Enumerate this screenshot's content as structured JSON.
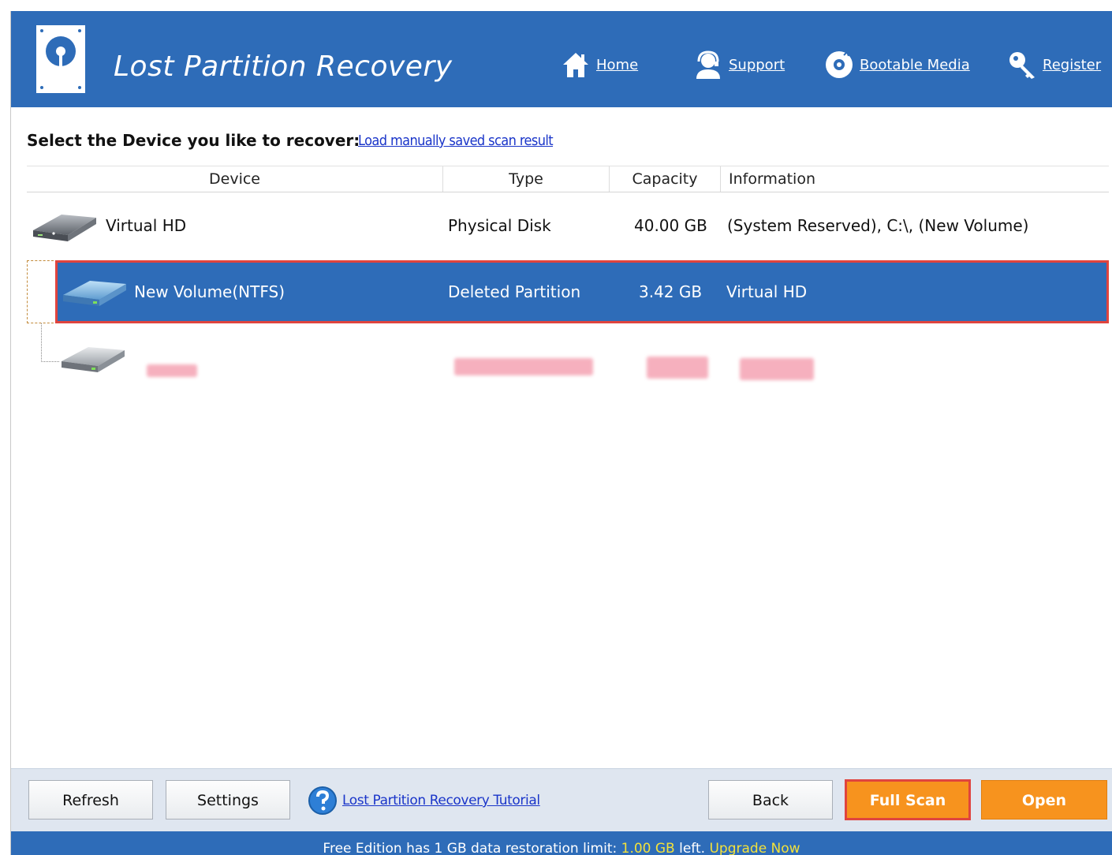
{
  "app": {
    "title": "Lost Partition Recovery"
  },
  "nav": [
    {
      "label": "Home",
      "icon": "home-icon"
    },
    {
      "label": "Support",
      "icon": "support-icon"
    },
    {
      "label": "Bootable Media",
      "icon": "disc-icon"
    },
    {
      "label": "Register",
      "icon": "key-icon"
    }
  ],
  "prompt": {
    "label": "Select the Device you like to recover:",
    "link": "Load manually saved scan result"
  },
  "table": {
    "columns": [
      "Device",
      "Type",
      "Capacity",
      "Information"
    ],
    "rows": [
      {
        "device": "Virtual HD",
        "type": "Physical Disk",
        "capacity": "40.00 GB",
        "information": "(System Reserved), C:\\, (New Volume)",
        "icon": "hard-disk-icon"
      },
      {
        "device": "New Volume(NTFS)",
        "type": "Deleted Partition",
        "capacity": "3.42 GB",
        "information": "Virtual HD",
        "icon": "partition-icon",
        "selected": true
      },
      {
        "device": "",
        "type": "",
        "capacity": "",
        "information": "",
        "icon": "partition-icon",
        "redacted": true
      }
    ]
  },
  "buttons": {
    "refresh": "Refresh",
    "settings": "Settings",
    "tutorial": "Lost Partition Recovery Tutorial",
    "back": "Back",
    "full_scan": "Full Scan",
    "open": "Open"
  },
  "status": {
    "prefix": "Free Edition has 1 GB data restoration limit: ",
    "left_amount": "1.00 GB",
    "suffix": " left. ",
    "upgrade": "Upgrade Now"
  },
  "colors": {
    "brand_blue": "#2e6cb8",
    "highlight_red": "#e0443e",
    "action_orange": "#f7931e",
    "status_yellow": "#f4e23a"
  }
}
